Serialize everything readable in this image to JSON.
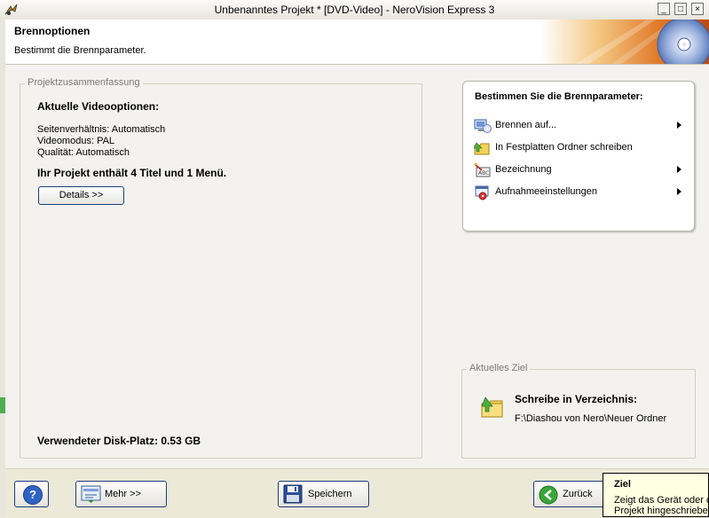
{
  "window": {
    "title": "Unbenanntes Projekt * [DVD-Video] - NeroVision Express 3",
    "buttons": [
      "_",
      "□",
      "×"
    ]
  },
  "header": {
    "title": "Brennoptionen",
    "subtitle": "Bestimmt die Brennparameter."
  },
  "summary": {
    "legend": "Projektzusammenfassung",
    "video_heading": "Aktuelle Videooptionen:",
    "aspect": "Seitenverhältnis: Automatisch",
    "mode": "Videomodus: PAL",
    "quality": "Qualität: Automatisch",
    "project_info": "Ihr Projekt enthält 4 Titel und 1 Menü.",
    "details_button": "Details >>",
    "disk_usage": "Verwendeter Disk-Platz: 0.53 GB"
  },
  "burn": {
    "heading": "Bestimmen Sie die Brennparameter:",
    "items": [
      {
        "label": "Brennen auf...",
        "icon": "computer-disc-icon",
        "has_submenu": true
      },
      {
        "label": "In Festplatten Ordner schreiben",
        "icon": "folder-arrow-icon",
        "has_submenu": false
      },
      {
        "label": "Bezeichnung",
        "icon": "label-icon",
        "has_submenu": true
      },
      {
        "label": "Aufnahmeeinstellungen",
        "icon": "record-settings-icon",
        "has_submenu": true
      }
    ]
  },
  "target": {
    "legend": "Aktuelles Ziel",
    "heading": "Schreibe in Verzeichnis:",
    "path": "F:\\Diashou von Nero\\Neuer Ordner"
  },
  "footer": {
    "help_label": "?",
    "more_button": "Mehr >>",
    "save_button": "Speichern",
    "back_button": "Zurück"
  },
  "tooltip": {
    "title": "Ziel",
    "line1": "Zeigt das Gerät oder d",
    "line2": "Projekt hingeschrieben"
  },
  "colors": {
    "accent": "#1c3b79",
    "panel_bg": "#f3f2ee",
    "tooltip_bg": "#ffffe1"
  }
}
